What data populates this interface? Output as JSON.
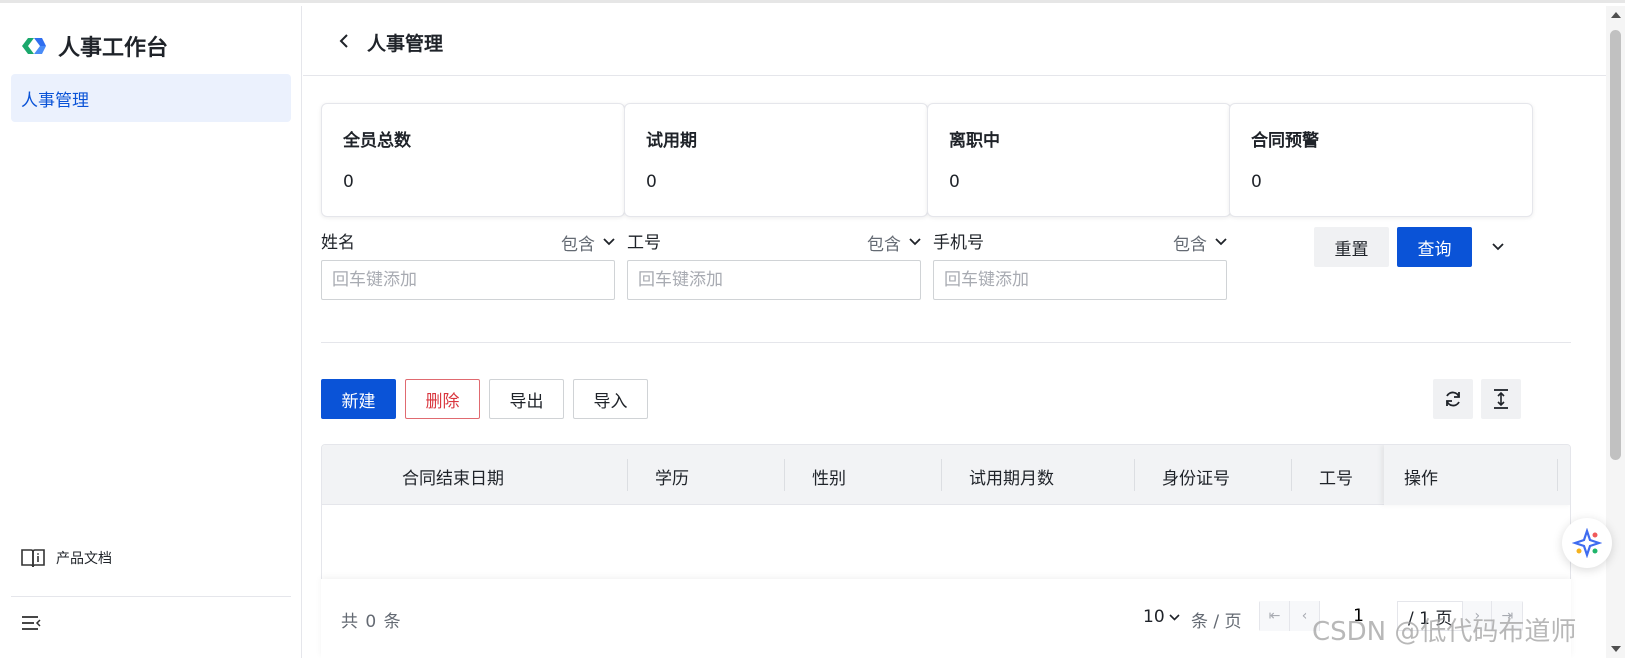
{
  "sidebar": {
    "brand_title": "人事工作台",
    "nav_items": [
      {
        "label": "人事管理",
        "active": true
      }
    ],
    "doc_link": "产品文档"
  },
  "header": {
    "title": "人事管理"
  },
  "stats": [
    {
      "label": "全员总数",
      "value": "0"
    },
    {
      "label": "试用期",
      "value": "0"
    },
    {
      "label": "离职中",
      "value": "0"
    },
    {
      "label": "合同预警",
      "value": "0"
    }
  ],
  "filters": [
    {
      "label": "姓名",
      "mode": "包含",
      "placeholder": "回车键添加"
    },
    {
      "label": "工号",
      "mode": "包含",
      "placeholder": "回车键添加"
    },
    {
      "label": "手机号",
      "mode": "包含",
      "placeholder": "回车键添加"
    }
  ],
  "filter_actions": {
    "reset": "重置",
    "query": "查询"
  },
  "toolbar": {
    "new": "新建",
    "delete": "删除",
    "export": "导出",
    "import": "导入"
  },
  "table": {
    "columns": [
      "合同结束日期",
      "学历",
      "性别",
      "试用期月数",
      "身份证号",
      "工号"
    ],
    "fixed_column": "操作",
    "rows": []
  },
  "pagination": {
    "total_text": "共 0 条",
    "page_size": "10",
    "per_page_label": "条 / 页",
    "current_page": "1",
    "total_pages_text": "/ 1 页"
  },
  "watermark": "CSDN @低代码布道师",
  "colors": {
    "primary": "#0a53d7",
    "danger": "#d9363e",
    "active_bg": "#ebf1fd"
  }
}
